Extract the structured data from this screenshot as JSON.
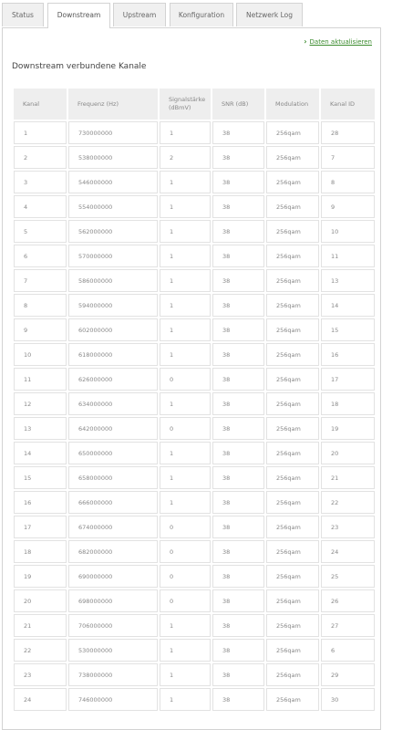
{
  "tabs": [
    {
      "label": "Status",
      "active": false
    },
    {
      "label": "Downstream",
      "active": true
    },
    {
      "label": "Upstream",
      "active": false
    },
    {
      "label": "Konfiguration",
      "active": false
    },
    {
      "label": "Netzwerk Log",
      "active": false
    }
  ],
  "refresh_link": "Daten aktualisieren",
  "section_title": "Downstream verbundene Kanale",
  "table": {
    "headers": {
      "kanal": "Kanal",
      "frequenz": "Frequenz (Hz)",
      "signal_line1": "Signalstärke",
      "signal_line2": "(dBmV)",
      "snr": "SNR (dB)",
      "modulation": "Modulation",
      "kanal_id": "Kanal ID"
    },
    "rows": [
      {
        "kanal": "1",
        "frequenz": "730000000",
        "signal": "1",
        "snr": "38",
        "modulation": "256qam",
        "kanal_id": "28"
      },
      {
        "kanal": "2",
        "frequenz": "538000000",
        "signal": "2",
        "snr": "38",
        "modulation": "256qam",
        "kanal_id": "7"
      },
      {
        "kanal": "3",
        "frequenz": "546000000",
        "signal": "1",
        "snr": "38",
        "modulation": "256qam",
        "kanal_id": "8"
      },
      {
        "kanal": "4",
        "frequenz": "554000000",
        "signal": "1",
        "snr": "38",
        "modulation": "256qam",
        "kanal_id": "9"
      },
      {
        "kanal": "5",
        "frequenz": "562000000",
        "signal": "1",
        "snr": "38",
        "modulation": "256qam",
        "kanal_id": "10"
      },
      {
        "kanal": "6",
        "frequenz": "570000000",
        "signal": "1",
        "snr": "38",
        "modulation": "256qam",
        "kanal_id": "11"
      },
      {
        "kanal": "7",
        "frequenz": "586000000",
        "signal": "1",
        "snr": "38",
        "modulation": "256qam",
        "kanal_id": "13"
      },
      {
        "kanal": "8",
        "frequenz": "594000000",
        "signal": "1",
        "snr": "38",
        "modulation": "256qam",
        "kanal_id": "14"
      },
      {
        "kanal": "9",
        "frequenz": "602000000",
        "signal": "1",
        "snr": "38",
        "modulation": "256qam",
        "kanal_id": "15"
      },
      {
        "kanal": "10",
        "frequenz": "618000000",
        "signal": "1",
        "snr": "38",
        "modulation": "256qam",
        "kanal_id": "16"
      },
      {
        "kanal": "11",
        "frequenz": "626000000",
        "signal": "0",
        "snr": "38",
        "modulation": "256qam",
        "kanal_id": "17"
      },
      {
        "kanal": "12",
        "frequenz": "634000000",
        "signal": "1",
        "snr": "38",
        "modulation": "256qam",
        "kanal_id": "18"
      },
      {
        "kanal": "13",
        "frequenz": "642000000",
        "signal": "0",
        "snr": "38",
        "modulation": "256qam",
        "kanal_id": "19"
      },
      {
        "kanal": "14",
        "frequenz": "650000000",
        "signal": "1",
        "snr": "38",
        "modulation": "256qam",
        "kanal_id": "20"
      },
      {
        "kanal": "15",
        "frequenz": "658000000",
        "signal": "1",
        "snr": "38",
        "modulation": "256qam",
        "kanal_id": "21"
      },
      {
        "kanal": "16",
        "frequenz": "666000000",
        "signal": "1",
        "snr": "38",
        "modulation": "256qam",
        "kanal_id": "22"
      },
      {
        "kanal": "17",
        "frequenz": "674000000",
        "signal": "0",
        "snr": "38",
        "modulation": "256qam",
        "kanal_id": "23"
      },
      {
        "kanal": "18",
        "frequenz": "682000000",
        "signal": "0",
        "snr": "38",
        "modulation": "256qam",
        "kanal_id": "24"
      },
      {
        "kanal": "19",
        "frequenz": "690000000",
        "signal": "0",
        "snr": "38",
        "modulation": "256qam",
        "kanal_id": "25"
      },
      {
        "kanal": "20",
        "frequenz": "698000000",
        "signal": "0",
        "snr": "38",
        "modulation": "256qam",
        "kanal_id": "26"
      },
      {
        "kanal": "21",
        "frequenz": "706000000",
        "signal": "1",
        "snr": "38",
        "modulation": "256qam",
        "kanal_id": "27"
      },
      {
        "kanal": "22",
        "frequenz": "530000000",
        "signal": "1",
        "snr": "38",
        "modulation": "256qam",
        "kanal_id": "6"
      },
      {
        "kanal": "23",
        "frequenz": "738000000",
        "signal": "1",
        "snr": "38",
        "modulation": "256qam",
        "kanal_id": "29"
      },
      {
        "kanal": "24",
        "frequenz": "746000000",
        "signal": "1",
        "snr": "38",
        "modulation": "256qam",
        "kanal_id": "30"
      }
    ]
  },
  "colors": {
    "accent_link": "#3b8b2e",
    "header_bg": "#eeeeee",
    "border": "#e2e2e2"
  }
}
